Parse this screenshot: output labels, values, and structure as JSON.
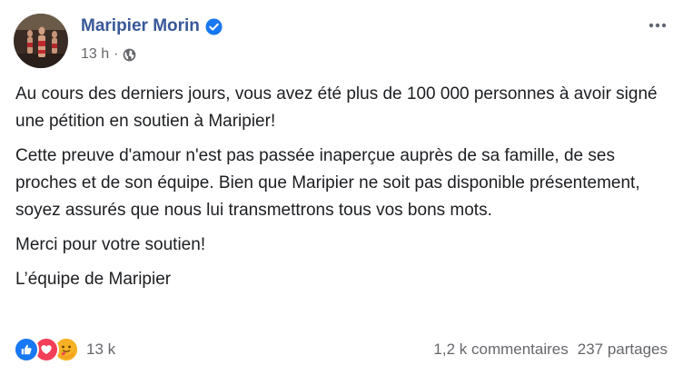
{
  "post": {
    "author": "Maripier Morin",
    "timestamp": "13 h",
    "separator": "·",
    "verified_icon": "verified-badge-icon",
    "privacy_icon": "globe-icon",
    "more_icon": "more-options-icon",
    "paragraphs": [
      "Au cours des derniers jours, vous avez été plus de 100 000 personnes à avoir signé une pétition en soutien à Maripier!",
      "Cette preuve d'amour n'est pas passée inaperçue auprès de sa famille, de ses proches et de son équipe. Bien que Maripier ne soit pas disponible présentement, soyez assurés que nous lui transmettrons tous vos bons mots.",
      "Merci pour votre soutien!",
      "L’équipe de Maripier"
    ]
  },
  "stats": {
    "reaction_icons": [
      "like-icon",
      "love-icon",
      "care-icon"
    ],
    "reactions": "13 k",
    "comments": "1,2 k commentaires",
    "shares": "237 partages"
  },
  "colors": {
    "author": "#385898",
    "meta": "#65676b",
    "text": "#1c1e21",
    "like": "#1877f2",
    "love": "#f33e58",
    "care": "#f7b125"
  }
}
